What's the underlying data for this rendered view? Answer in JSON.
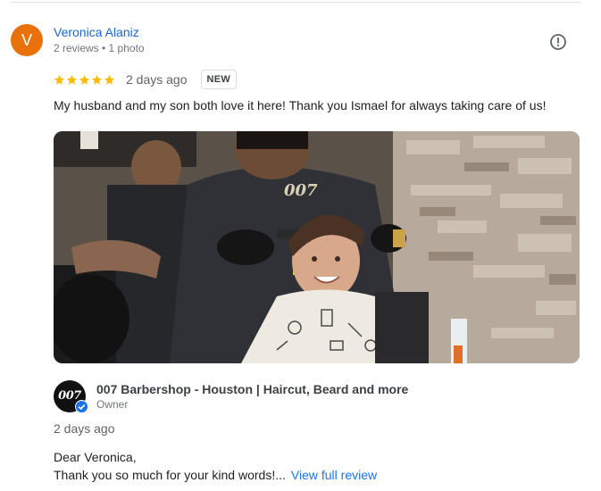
{
  "review": {
    "avatar_letter": "V",
    "avatar_color": "#e8710a",
    "reviewer_name": "Veronica Alaniz",
    "reviewer_meta": "2 reviews • 1 photo",
    "rating": 5,
    "star_color": "#fbbc04",
    "date": "2 days ago",
    "badge": "NEW",
    "text": "My husband and my son both love it here! Thank you Ismael for always taking care of us!",
    "report_icon": "report-icon",
    "photo_icon": "review-photo"
  },
  "owner_reply": {
    "logo_text": "007",
    "owner_name": "007 Barbershop - Houston | Haircut, Beard and more",
    "role": "Owner",
    "date": "2 days ago",
    "line1": "Dear Veronica,",
    "line2": "Thank you so much for your kind words!...",
    "view_full": "View full review",
    "link_color": "#1a73e8"
  }
}
